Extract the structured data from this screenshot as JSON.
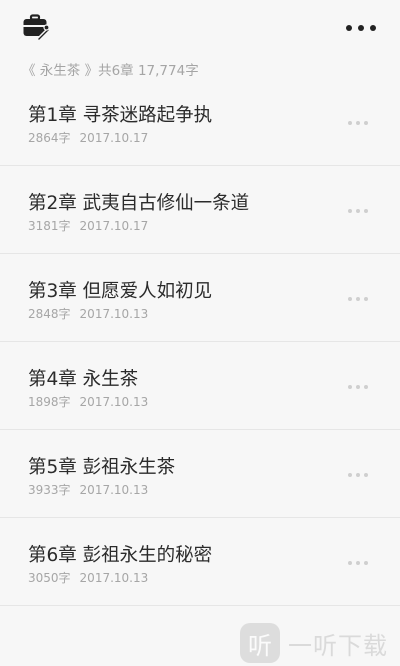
{
  "header": {
    "left_icon": "toolbox-icon",
    "right_icon": "more-dots-icon"
  },
  "summary": {
    "text": "《 永生茶 》共6章 17,774字"
  },
  "chapters": [
    {
      "title": "第1章 寻茶迷路起争执",
      "words": "2864字",
      "date": "2017.10.17"
    },
    {
      "title": "第2章 武夷自古修仙一条道",
      "words": "3181字",
      "date": "2017.10.17"
    },
    {
      "title": "第3章 但愿爱人如初见",
      "words": "2848字",
      "date": "2017.10.13"
    },
    {
      "title": "第4章 永生茶",
      "words": "1898字",
      "date": "2017.10.13"
    },
    {
      "title": "第5章 彭祖永生茶",
      "words": "3933字",
      "date": "2017.10.13"
    },
    {
      "title": "第6章 彭祖永生的秘密",
      "words": "3050字",
      "date": "2017.10.13"
    }
  ],
  "row_more_icon": "more-dots-icon",
  "watermark": {
    "logo_char": "听",
    "text": "一听下载"
  }
}
